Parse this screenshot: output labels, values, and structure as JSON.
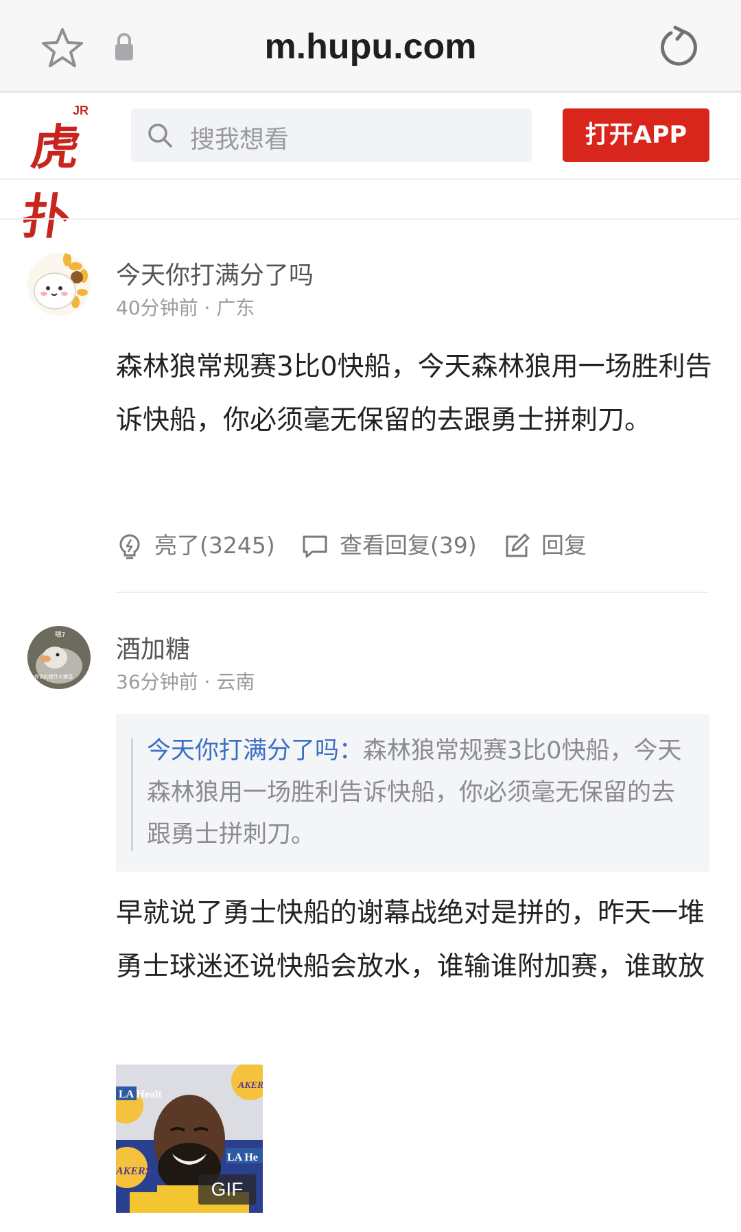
{
  "browser": {
    "url": "m.hupu.com"
  },
  "header": {
    "logo_text": "虎扑",
    "logo_badge": "JR",
    "search_placeholder": "搜我想看",
    "open_app_label": "打开APP",
    "brand_color": "#d9261c"
  },
  "comments": [
    {
      "username": "今天你打满分了吗",
      "meta": "40分钟前 · 广东",
      "content": "森林狼常规赛3比0快船，今天森林狼用一场胜利告诉快船，你必须毫无保留的去跟勇士拼刺刀。",
      "actions": {
        "like_label": "亮了(3245)",
        "view_replies_label": "查看回复(39)",
        "reply_label": "回复"
      }
    },
    {
      "username": "酒加糖",
      "meta": "36分钟前 · 云南",
      "avatar_caption_top": "嗯?",
      "avatar_caption_bottom": "你说的是什么猪话",
      "quote": {
        "name": "今天你打满分了吗：",
        "text": "森林狼常规赛3比0快船，今天森林狼用一场胜利告诉快船，你必须毫无保留的去跟勇士拼刺刀。"
      },
      "content": "早就说了勇士快船的谢幕战绝对是拼的，昨天一堆勇士球迷还说快船会放水，谁输谁附加赛，谁敢放",
      "gif": {
        "badge": "GIF",
        "bg_text_left": "LA Healt",
        "bg_text_right": "LA He",
        "bg_logo_text": "AKERS",
        "bg_logo_text_2": "AKER"
      }
    }
  ]
}
